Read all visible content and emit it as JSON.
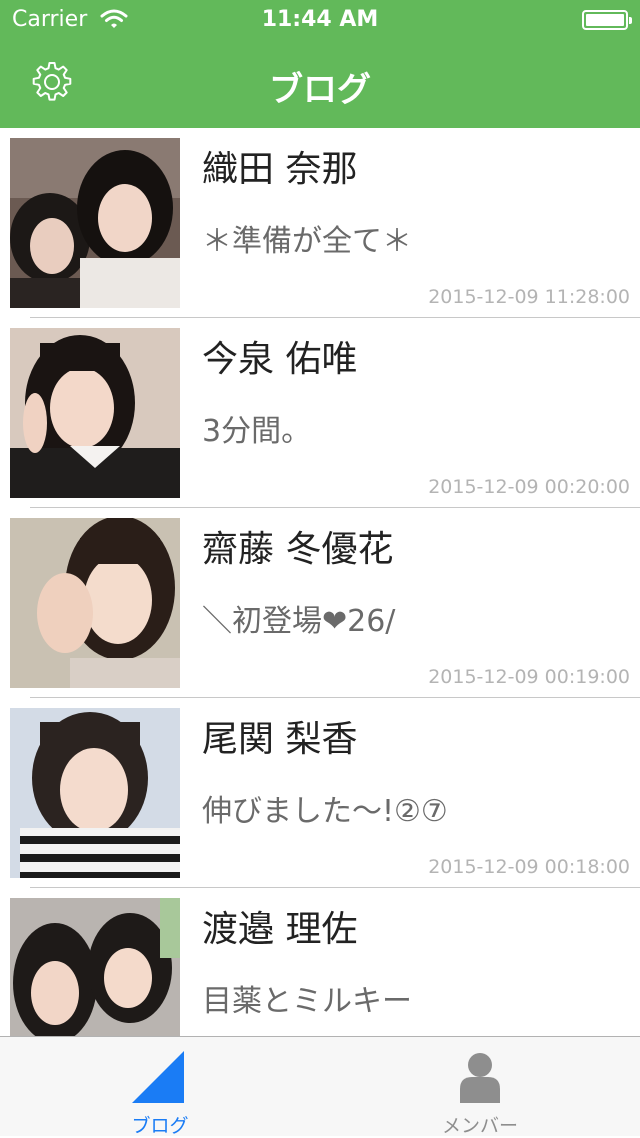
{
  "status_bar": {
    "carrier": "Carrier",
    "time": "11:44 AM"
  },
  "nav": {
    "title": "ブログ",
    "settings_icon": "gear-icon"
  },
  "posts": [
    {
      "name": "織田 奈那",
      "title": "＊準備が全て＊",
      "date": "2015-12-09 11:28:00"
    },
    {
      "name": "今泉 佑唯",
      "title": "3分間。",
      "date": "2015-12-09 00:20:00"
    },
    {
      "name": "齋藤 冬優花",
      "title": "＼初登場❤26/",
      "date": "2015-12-09 00:19:00"
    },
    {
      "name": "尾関 梨香",
      "title": "伸びました～!②⑦",
      "date": "2015-12-09 00:18:00"
    },
    {
      "name": "渡邉 理佐",
      "title": "目薬とミルキー",
      "date": ""
    }
  ],
  "tabs": [
    {
      "label": "ブログ",
      "icon": "blog-triangle-icon",
      "selected": true
    },
    {
      "label": "メンバー",
      "icon": "person-icon",
      "selected": false
    }
  ],
  "colors": {
    "accent": "#62b95a",
    "tab_active": "#1a7cf5",
    "tab_inactive": "#8e8e8e"
  }
}
